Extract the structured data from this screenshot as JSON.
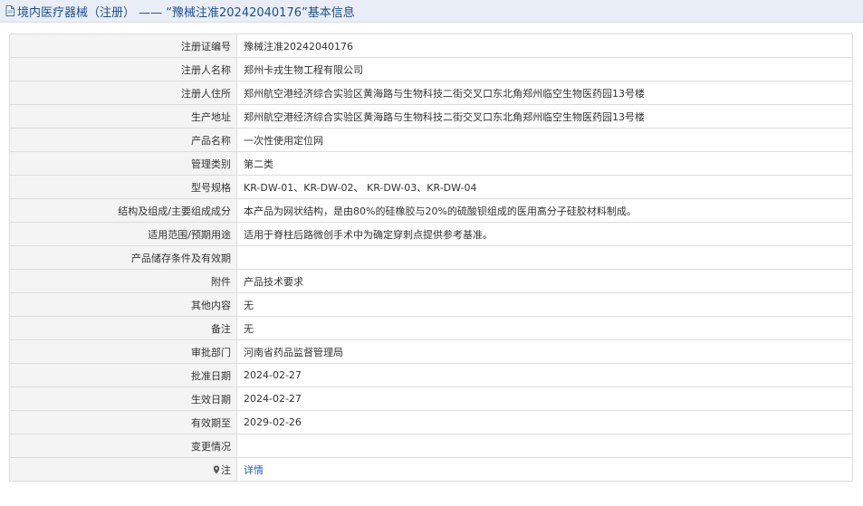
{
  "header": {
    "title": "境内医疗器械（注册） —— “豫械注准20242040176”基本信息"
  },
  "rows": [
    {
      "label": "注册证编号",
      "value": "豫械注准20242040176"
    },
    {
      "label": "注册人名称",
      "value": "郑州卡戎生物工程有限公司"
    },
    {
      "label": "注册人住所",
      "value": "郑州航空港经济综合实验区黄海路与生物科技二街交叉口东北角郑州临空生物医药园13号楼"
    },
    {
      "label": "生产地址",
      "value": "郑州航空港经济综合实验区黄海路与生物科技二街交叉口东北角郑州临空生物医药园13号楼"
    },
    {
      "label": "产品名称",
      "value": "一次性使用定位网"
    },
    {
      "label": "管理类别",
      "value": "第二类"
    },
    {
      "label": "型号规格",
      "value": "KR-DW-01、KR-DW-02、 KR-DW-03、KR-DW-04"
    },
    {
      "label": "结构及组成/主要组成成分",
      "value": "本产品为网状结构，是由80%的硅橡胶与20%的硫酸钡组成的医用高分子硅胶材料制成。"
    },
    {
      "label": "适用范围/预期用途",
      "value": "适用于脊柱后路微创手术中为确定穿刺点提供参考基准。"
    },
    {
      "label": "产品储存条件及有效期",
      "value": ""
    },
    {
      "label": "附件",
      "value": "产品技术要求"
    },
    {
      "label": "其他内容",
      "value": "无"
    },
    {
      "label": "备注",
      "value": "无"
    },
    {
      "label": "审批部门",
      "value": "河南省药品监督管理局"
    },
    {
      "label": "批准日期",
      "value": "2024-02-27"
    },
    {
      "label": "生效日期",
      "value": "2024-02-27"
    },
    {
      "label": "有效期至",
      "value": "2029-02-26"
    },
    {
      "label": "变更情况",
      "value": ""
    },
    {
      "label": "注",
      "value": "详情"
    }
  ]
}
